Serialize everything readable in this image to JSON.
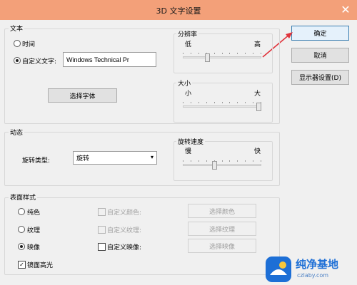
{
  "window": {
    "title": "3D 文字设置",
    "close_glyph": "✕"
  },
  "buttons": {
    "ok": "确定",
    "cancel": "取消",
    "display_settings": "显示器设置(D)"
  },
  "text_group": {
    "label": "文本",
    "time_label": "时间",
    "custom_text_label": "自定义文字:",
    "custom_text_value": "Windows Technical Pr",
    "choose_font": "选择字体",
    "selected_mode": "custom_text"
  },
  "resolution": {
    "label": "分辨率",
    "low": "低",
    "high": "高",
    "value": 0.3
  },
  "size": {
    "label": "大小",
    "small": "小",
    "large": "大",
    "value": 1.0
  },
  "motion_group": {
    "label": "动态",
    "rotation_type_label": "旋转类型:",
    "rotation_type_value": "旋转"
  },
  "rotation_speed": {
    "label": "旋转速度",
    "slow": "慢",
    "fast": "快",
    "value": 0.4
  },
  "surface_group": {
    "label": "表面样式",
    "solid": "纯色",
    "texture": "纹理",
    "reflection": "映像",
    "custom_color": "自定义颜色:",
    "custom_texture": "自定义纹理:",
    "custom_reflection": "自定义映像:",
    "choose_color": "选择颜色",
    "choose_texture": "选择纹理",
    "choose_reflection": "选择映像",
    "mirror_highlight": "镜面高光",
    "selected": "reflection",
    "mirror_highlight_checked": true,
    "check_glyph": "✓"
  },
  "watermark": {
    "text": "纯净基地",
    "sub": "czlaby.com"
  },
  "colors": {
    "title_bar": "#f3a079",
    "arrow": "#e0343c",
    "watermark_blue": "#1d6fd6"
  }
}
